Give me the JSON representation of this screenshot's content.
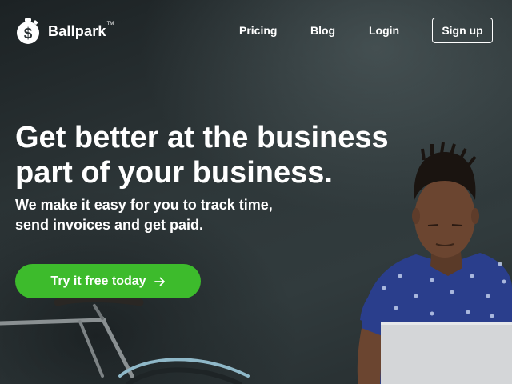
{
  "brand": {
    "name": "Ballpark",
    "trademark": "TM"
  },
  "nav": {
    "items": [
      {
        "label": "Pricing"
      },
      {
        "label": "Blog"
      },
      {
        "label": "Login"
      }
    ],
    "signup_label": "Sign up"
  },
  "hero": {
    "headline_line1": "Get better at the business",
    "headline_line2": "part of your business.",
    "subhead_line1": "We make it easy for you to track time,",
    "subhead_line2": "send invoices and get paid.",
    "cta_label": "Try it free today",
    "cta_icon": "arrow-right-icon"
  },
  "colors": {
    "cta_green": "#3dbb2c",
    "background_dark": "#2b3234",
    "text": "#ffffff"
  }
}
